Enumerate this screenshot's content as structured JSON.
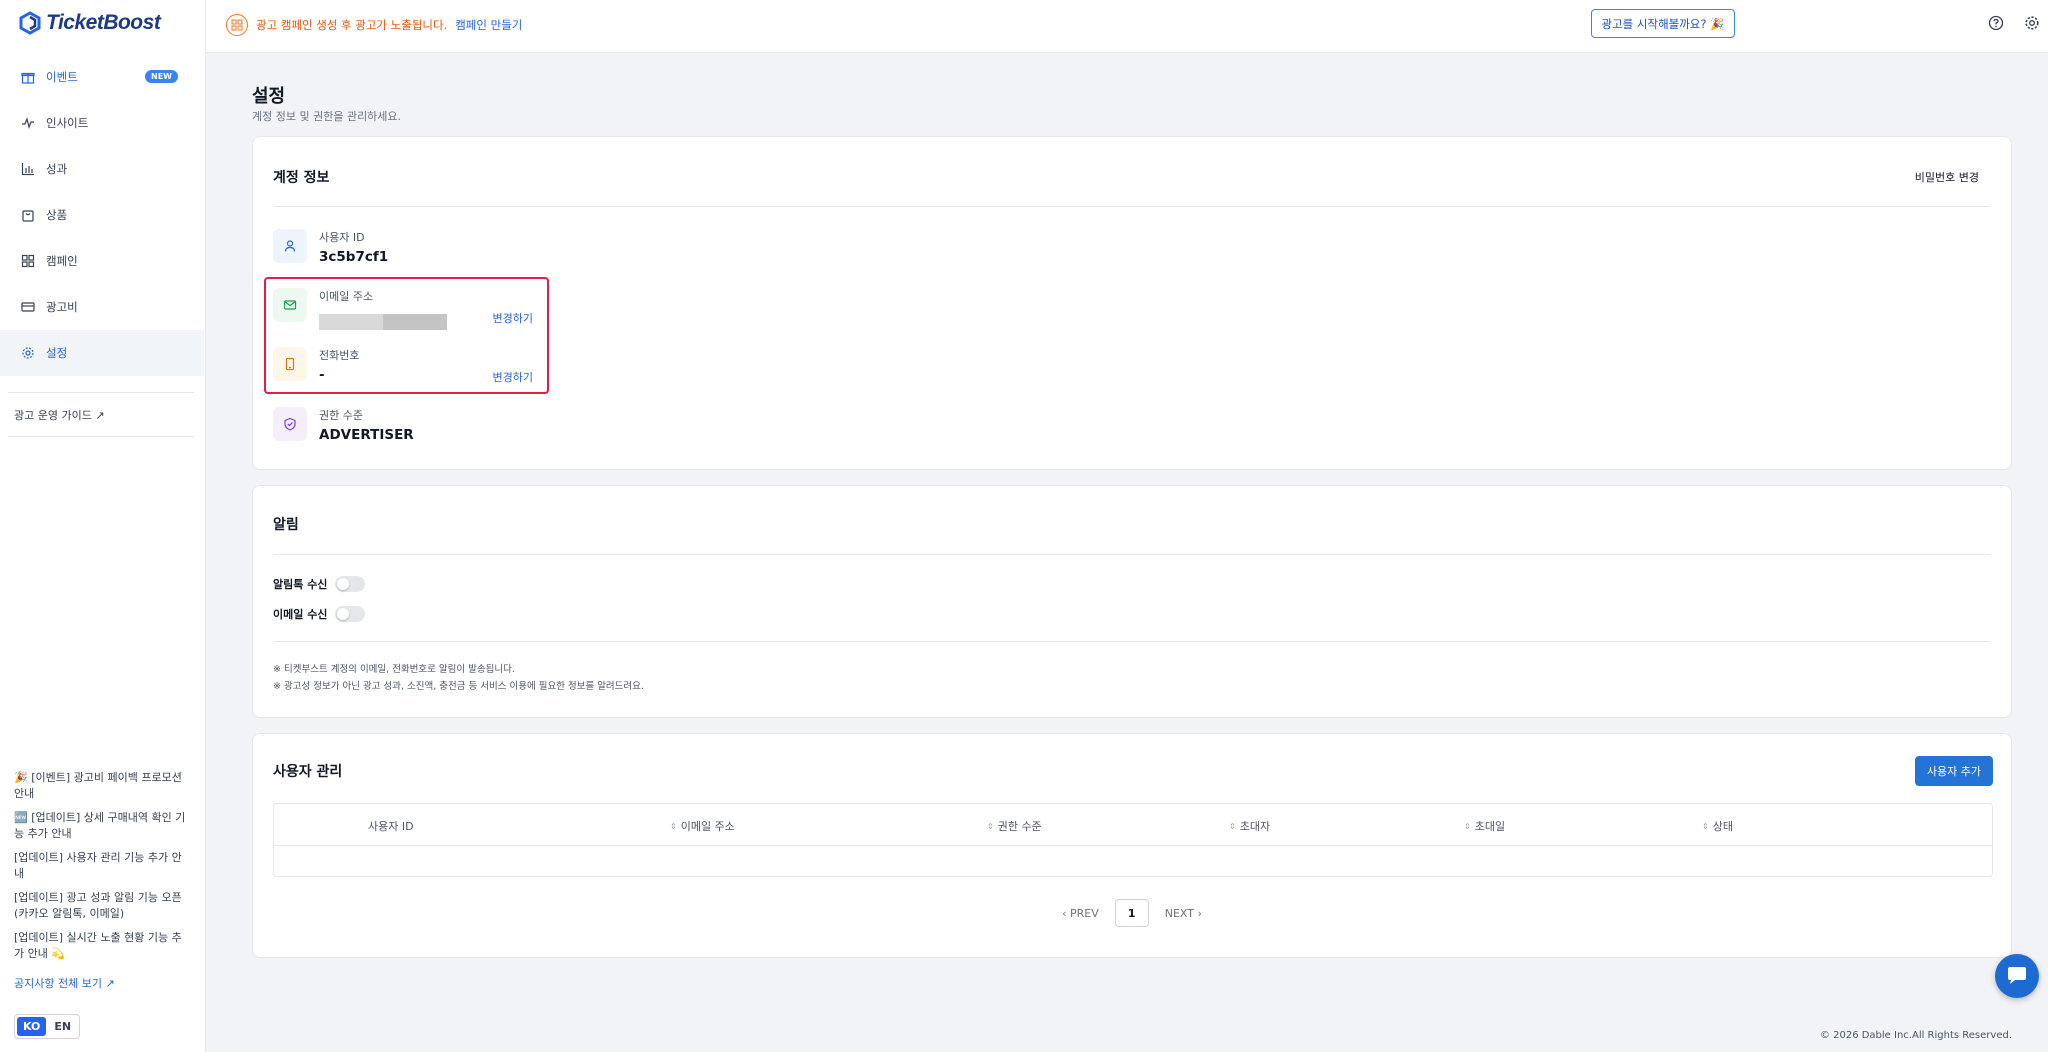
{
  "brand": {
    "name": "TicketBoost"
  },
  "sidebar": {
    "items": [
      {
        "label": "이벤트",
        "badge": "NEW"
      },
      {
        "label": "인사이트"
      },
      {
        "label": "성과"
      },
      {
        "label": "상품"
      },
      {
        "label": "캠페인"
      },
      {
        "label": "광고비"
      },
      {
        "label": "설정"
      }
    ],
    "guide_link": "광고 운영 가이드 ↗",
    "notices": [
      "🎉 [이벤트] 광고비 페이백 프로모션 안내",
      "🆕 [업데이트] 상세 구매내역 확인 기능 추가 안내",
      "[업데이트] 사용자 관리 기능 추가 안내",
      "[업데이트] 광고 성과 알림 기능 오픈 (카카오 알림톡, 이메일)",
      "[업데이트] 실시간 노출 현황 기능 추가 안내 💫"
    ],
    "notice_all": "공지사항 전체 보기 ↗",
    "lang": {
      "ko": "KO",
      "en": "EN"
    }
  },
  "topbar": {
    "alert_text": "광고 캠페인 생성 후 광고가 노출됩니다.",
    "alert_link": "캠페인 만들기",
    "start_button": "광고를 시작해볼까요? 🎉"
  },
  "page": {
    "title": "설정",
    "subtitle": "계정 정보 및 권한을 관리하세요."
  },
  "account": {
    "title": "계정 정보",
    "password_link": "비밀번호 변경",
    "user_id_label": "사용자 ID",
    "user_id_value": "3c5b7cf1",
    "email_label": "이메일 주소",
    "email_change": "변경하기",
    "phone_label": "전화번호",
    "phone_value": "-",
    "phone_change": "변경하기",
    "role_label": "권한 수준",
    "role_value": "ADVERTISER"
  },
  "notifications": {
    "title": "알림",
    "alimtalk_label": "알림톡 수신",
    "email_label": "이메일 수신",
    "alimtalk_on": false,
    "email_on": false,
    "note1": "※ 티켓부스트 계정의 이메일, 전화번호로 알림이 발송됩니다.",
    "note2": "※ 광고성 정보가 아닌 광고 성과, 소진액, 충전금 등 서비스 이용에 필요한 정보를 알려드려요."
  },
  "users": {
    "title": "사용자 관리",
    "add_button": "사용자 추가",
    "columns": [
      "사용자 ID",
      "이메일 주소",
      "권한 수준",
      "초대자",
      "초대일",
      "상태"
    ],
    "rows": [],
    "pager": {
      "prev": "PREV",
      "page": "1",
      "next": "NEXT"
    }
  },
  "footer": "© 2026 Dable Inc.All Rights Reserved.",
  "colors": {
    "primary": "#2473d6",
    "alert": "#ea580c",
    "highlight": "#e11d48"
  }
}
